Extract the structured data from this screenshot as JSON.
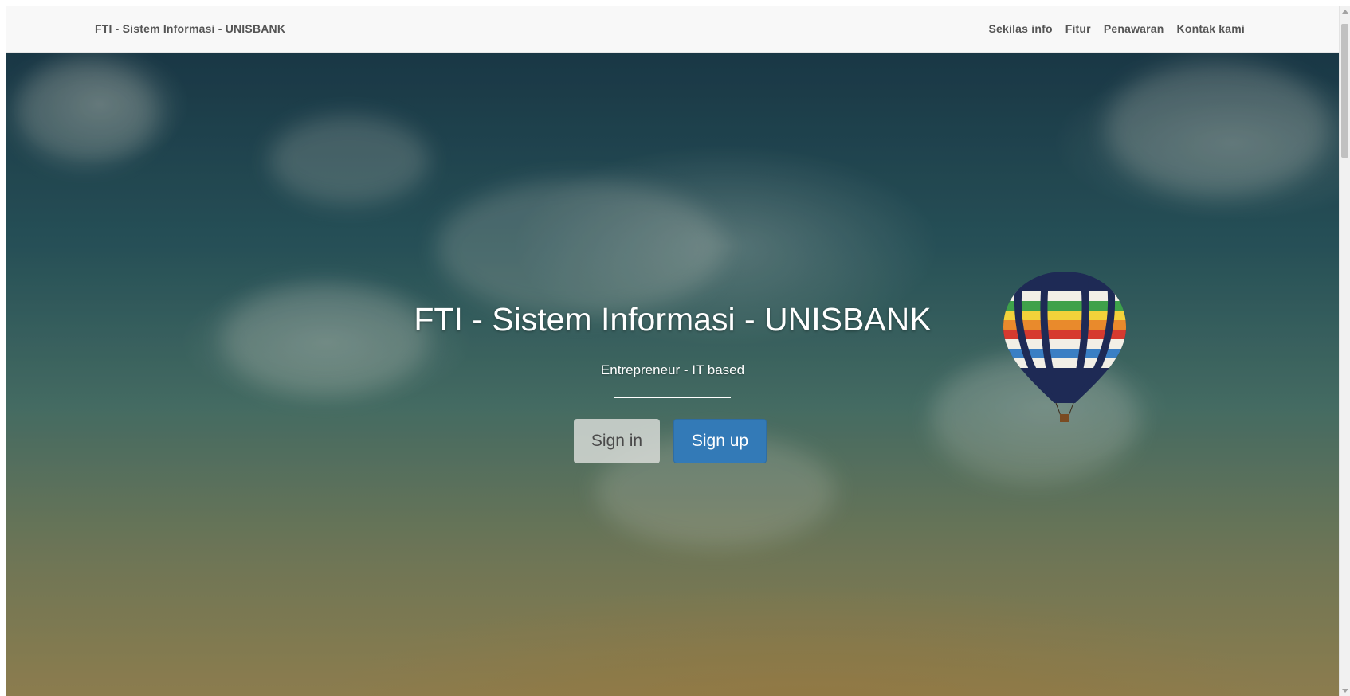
{
  "navbar": {
    "brand": "FTI - Sistem Informasi - UNISBANK",
    "links": [
      "Sekilas info",
      "Fitur",
      "Penawaran",
      "Kontak kami"
    ]
  },
  "hero": {
    "title": "FTI - Sistem Informasi - UNISBANK",
    "subtitle": "Entrepreneur - IT based",
    "buttons": {
      "signin": "Sign in",
      "signup": "Sign up"
    }
  },
  "colors": {
    "navbar_bg": "#f8f8f8",
    "primary_button": "#337ab7",
    "default_button": "#dcdcda",
    "nav_text": "#555555"
  },
  "icons": {
    "balloon": "hot-air-balloon-icon"
  }
}
